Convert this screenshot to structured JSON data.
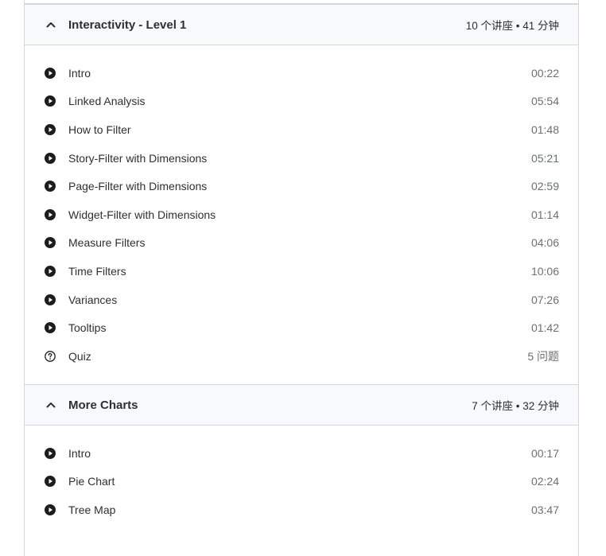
{
  "sections": [
    {
      "title": "Interactivity - Level 1",
      "meta": "10 个讲座 • 41 分钟",
      "items": [
        {
          "label": "Intro",
          "duration": "00:22",
          "icon": "play-circle-icon"
        },
        {
          "label": "Linked Analysis",
          "duration": "05:54",
          "icon": "play-circle-icon"
        },
        {
          "label": "How to Filter",
          "duration": "01:48",
          "icon": "play-circle-icon"
        },
        {
          "label": "Story-Filter with Dimensions",
          "duration": "05:21",
          "icon": "play-circle-icon"
        },
        {
          "label": "Page-Filter with Dimensions",
          "duration": "02:59",
          "icon": "play-circle-icon"
        },
        {
          "label": "Widget-Filter with Dimensions",
          "duration": "01:14",
          "icon": "play-circle-icon"
        },
        {
          "label": "Measure Filters",
          "duration": "04:06",
          "icon": "play-circle-icon"
        },
        {
          "label": "Time Filters",
          "duration": "10:06",
          "icon": "play-circle-icon"
        },
        {
          "label": "Variances",
          "duration": "07:26",
          "icon": "play-circle-icon"
        },
        {
          "label": "Tooltips",
          "duration": "01:42",
          "icon": "play-circle-icon"
        },
        {
          "label": "Quiz",
          "duration": "5 问题",
          "icon": "question-circle-icon"
        }
      ]
    },
    {
      "title": "More Charts",
      "meta": "7 个讲座 • 32 分钟",
      "items": [
        {
          "label": "Intro",
          "duration": "00:17",
          "icon": "play-circle-icon"
        },
        {
          "label": "Pie Chart",
          "duration": "02:24",
          "icon": "play-circle-icon"
        },
        {
          "label": "Tree Map",
          "duration": "03:47",
          "icon": "play-circle-icon"
        }
      ]
    }
  ]
}
